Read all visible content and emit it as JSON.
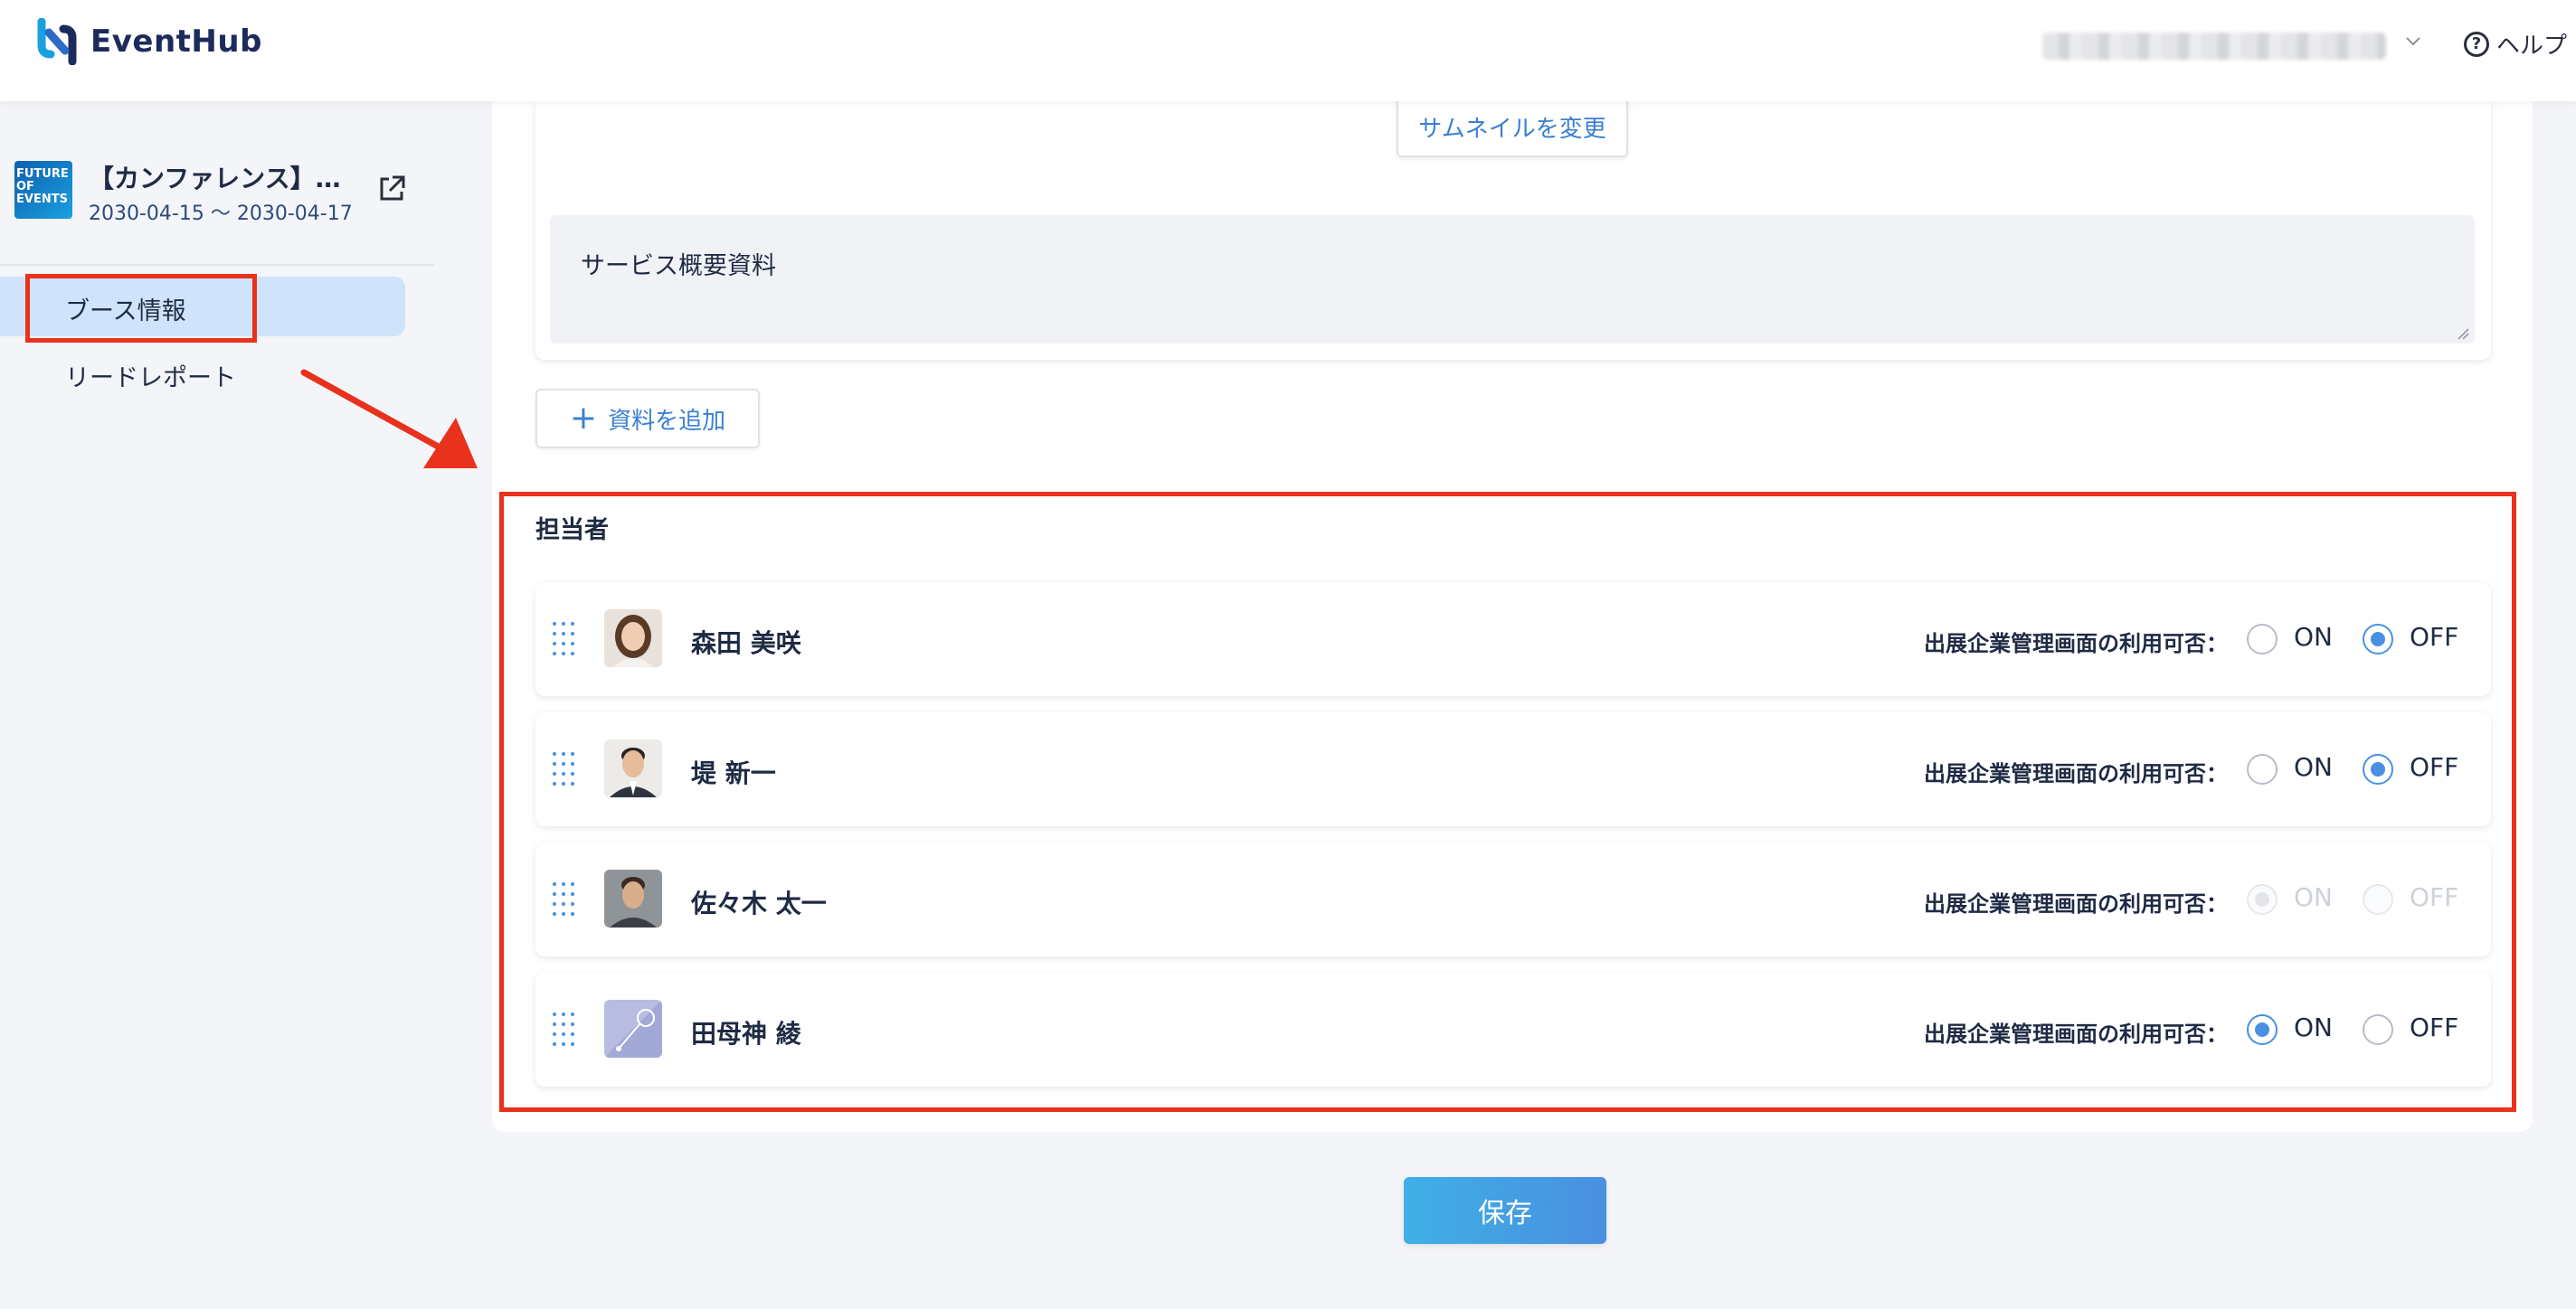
{
  "app": {
    "name": "EventHub"
  },
  "header": {
    "help_label": "ヘルプ"
  },
  "sidebar": {
    "event_title": "【カンファレンス】…",
    "event_dates": "2030-04-15 〜 2030-04-17",
    "event_thumb_text": "FUTURE OF EVENTS",
    "nav": [
      {
        "label": "ブース情報",
        "active": true
      },
      {
        "label": "リードレポート",
        "active": false
      }
    ]
  },
  "materials": {
    "thumbnail_button": "サムネイルを変更",
    "description": "サービス概要資料",
    "add_button": "資料を追加"
  },
  "staff": {
    "section_title": "担当者",
    "access_label": "出展企業管理画面の利用可否：",
    "on_label": "ON",
    "off_label": "OFF",
    "members": [
      {
        "name": "森田 美咲",
        "value": "OFF",
        "disabled": false
      },
      {
        "name": "堤 新一",
        "value": "OFF",
        "disabled": false
      },
      {
        "name": "佐々木 太一",
        "value": "ON",
        "disabled": true
      },
      {
        "name": "田母神 綾",
        "value": "ON",
        "disabled": false
      }
    ]
  },
  "footer": {
    "save_button": "保存"
  },
  "colors": {
    "accent": "#4a90e2",
    "annotation": "#e8321e",
    "nav_active_bg": "#cfe3fb"
  }
}
